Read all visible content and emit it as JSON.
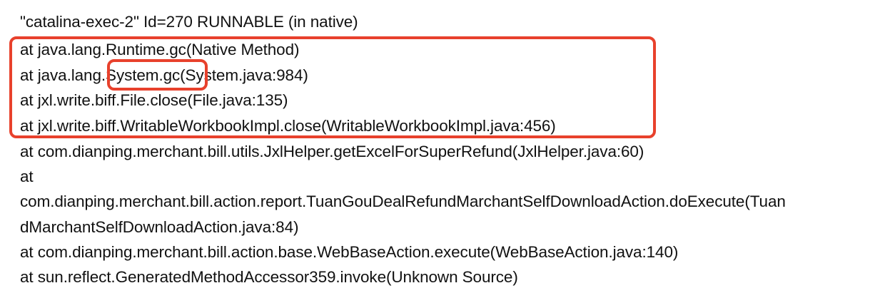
{
  "stack_trace": {
    "lines": [
      "\"catalina-exec-2\" Id=270 RUNNABLE (in native)",
      "at java.lang.Runtime.gc(Native Method)",
      "at java.lang.System.gc(System.java:984)",
      "at jxl.write.biff.File.close(File.java:135)",
      "at jxl.write.biff.WritableWorkbookImpl.close(WritableWorkbookImpl.java:456)",
      "at com.dianping.merchant.bill.utils.JxlHelper.getExcelForSuperRefund(JxlHelper.java:60)",
      "at",
      "com.dianping.merchant.bill.action.report.TuanGouDealRefundMarchantSelfDownloadAction.doExecute(Tuan",
      "dMarchantSelfDownloadAction.java:84)",
      "at com.dianping.merchant.bill.action.base.WebBaseAction.execute(WebBaseAction.java:140)",
      "at sun.reflect.GeneratedMethodAccessor359.invoke(Unknown Source)"
    ]
  },
  "annotations": {
    "highlight_color": "#e8412c"
  }
}
